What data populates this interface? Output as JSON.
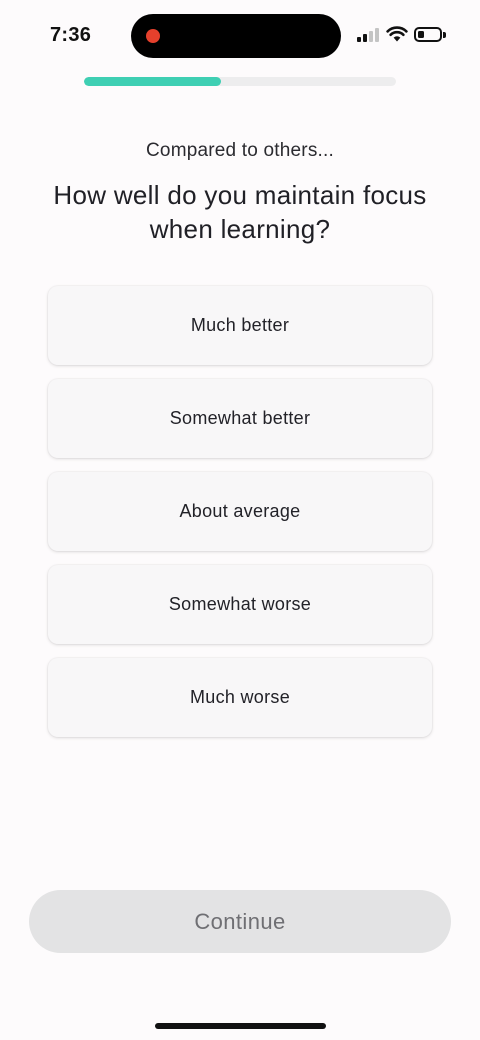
{
  "status_bar": {
    "time": "7:36",
    "recording_color": "#e5402c",
    "icons": [
      "cellular-signal-icon",
      "wifi-icon",
      "battery-icon"
    ]
  },
  "progress": {
    "fraction": 0.44,
    "color": "#3fcfb3"
  },
  "header": {
    "subtitle": "Compared to others...",
    "question": "How well do you maintain focus when learning?"
  },
  "options": [
    {
      "label": "Much better"
    },
    {
      "label": "Somewhat better"
    },
    {
      "label": "About average"
    },
    {
      "label": "Somewhat worse"
    },
    {
      "label": "Much worse"
    }
  ],
  "footer": {
    "continue_label": "Continue",
    "continue_enabled": false
  }
}
